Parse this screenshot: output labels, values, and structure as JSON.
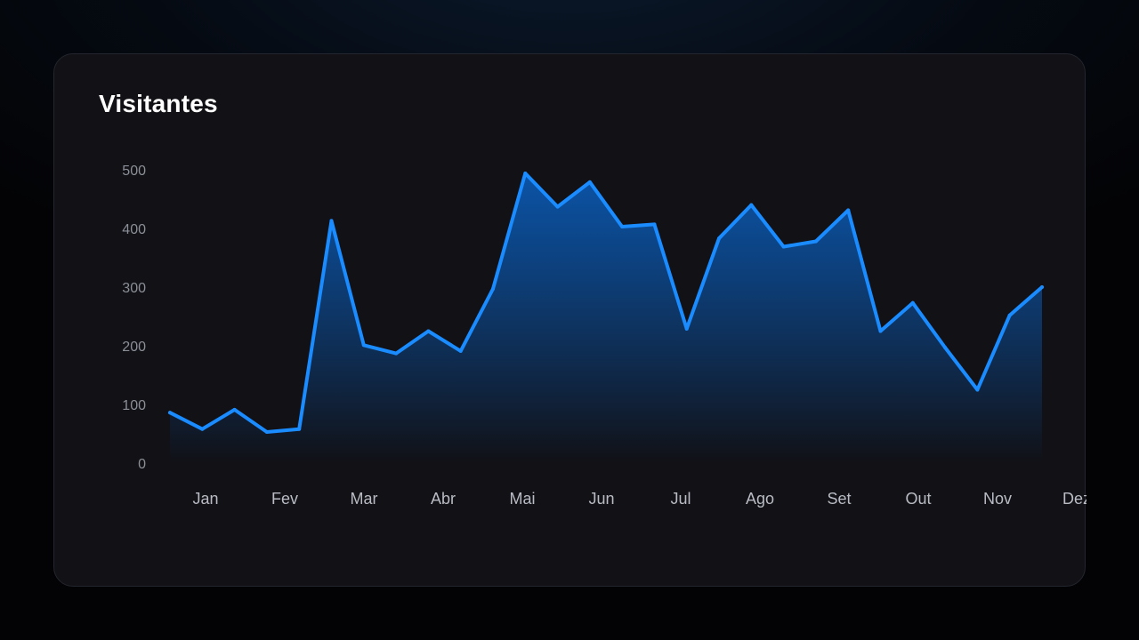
{
  "chart_data": {
    "type": "area",
    "title": "Visitantes",
    "xlabel": "",
    "ylabel": "",
    "ylim": [
      0,
      500
    ],
    "yticks": [
      0,
      100,
      200,
      300,
      400,
      500
    ],
    "month_labels": [
      "Jan",
      "Fev",
      "Mar",
      "Abr",
      "Mai",
      "Jun",
      "Jul",
      "Ago",
      "Set",
      "Out",
      "Nov",
      "Dez"
    ],
    "grid": false,
    "legend": "none",
    "series": [
      {
        "values": [
          86,
          58,
          91,
          53,
          58,
          413,
          201,
          187,
          225,
          191,
          297,
          494,
          437,
          479,
          403,
          407,
          229,
          383,
          440,
          369,
          378,
          431,
          225,
          273,
          197,
          125,
          252,
          300
        ]
      }
    ],
    "colors": {
      "line": "#1a8cff",
      "fill_top": "#0a5fbf",
      "fill_bottom": "#111116"
    }
  }
}
